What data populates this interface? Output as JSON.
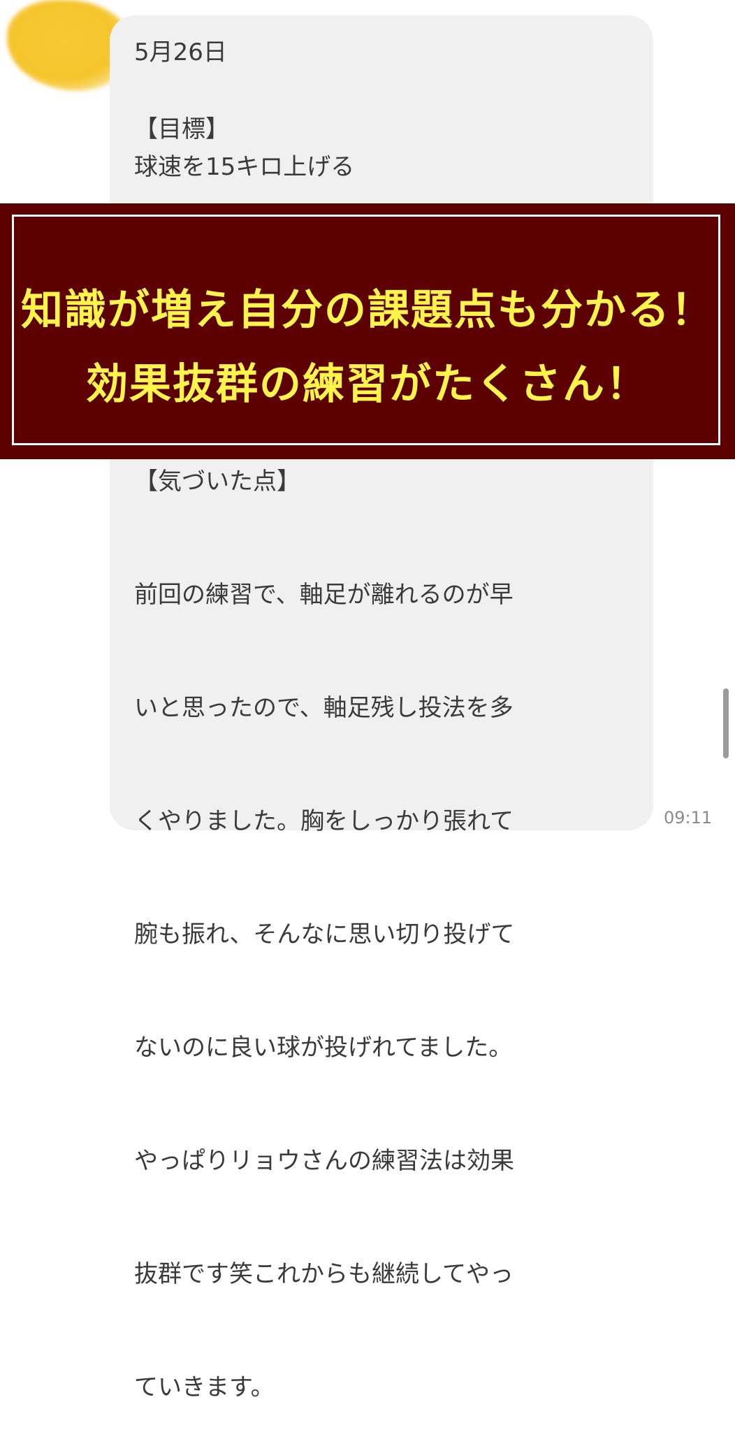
{
  "message": {
    "date": "5月26日",
    "goal_heading": "【目標】",
    "goal_text": "球速を15キロ上げる",
    "notice_heading": "【気づいた点】",
    "notice_lines": [
      "前回の練習で、軸足が離れるのが早",
      "いと思ったので、軸足残し投法を多",
      "くやりました。胸をしっかり張れて",
      "腕も振れ、そんなに思い切り投げて",
      "ないのに良い球が投げれてました。",
      "やっぱりリョウさんの練習法は効果",
      "抜群です笑これからも継続してやっ",
      "ていきます。"
    ],
    "time": "09:11"
  },
  "banner": {
    "line1": "知識が増え自分の課題点も分かる！",
    "line2": "効果抜群の練習がたくさん！",
    "text_color": "#fff44a",
    "background_color": "#5c0000"
  },
  "colors": {
    "bubble": "#f0f0f1",
    "avatar_blur": "#f6c52d"
  }
}
